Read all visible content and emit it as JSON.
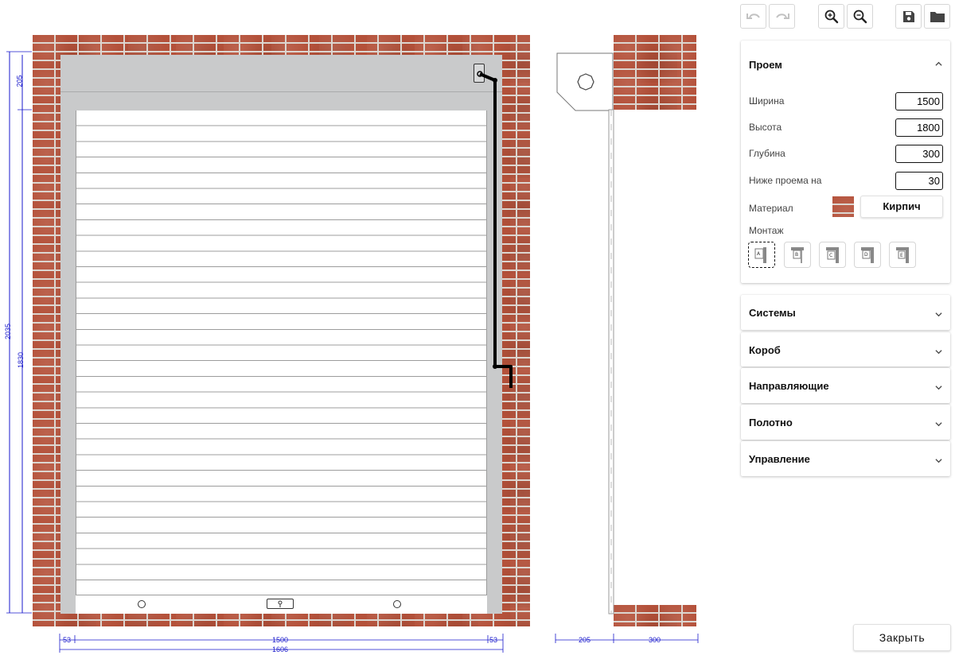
{
  "toolbar": {
    "undo_icon": "undo-icon",
    "redo_icon": "redo-icon",
    "zoom_in_icon": "zoom-in-icon",
    "zoom_out_icon": "zoom-out-icon",
    "save_icon": "save-icon",
    "open_icon": "folder-icon"
  },
  "opening": {
    "title": "Проем",
    "width_label": "Ширина",
    "width_value": "1500",
    "height_label": "Высота",
    "height_value": "1800",
    "depth_label": "Глубина",
    "depth_value": "300",
    "below_label": "Ниже проема на",
    "below_value": "30",
    "material_label": "Материал",
    "material_value": "Кирпич",
    "mount_label": "Монтаж",
    "mount_options": [
      "A",
      "B",
      "C",
      "D",
      "E"
    ],
    "mount_selected": "A"
  },
  "sections": [
    "Системы",
    "Короб",
    "Направляющие",
    "Полотно",
    "Управление"
  ],
  "close_label": "Закрыть",
  "dimensions": {
    "front_left_top": "205",
    "front_left_total": "2035",
    "front_left_inner": "1830",
    "front_bottom_left": "53",
    "front_bottom_mid": "1500",
    "front_bottom_right": "53",
    "front_bottom_total": "1606",
    "side_bottom_left": "205",
    "side_bottom_right": "300"
  },
  "colors": {
    "accent_dim": "#1a1acc",
    "box_gray": "#c9cacb",
    "brick": "#a8452f"
  }
}
